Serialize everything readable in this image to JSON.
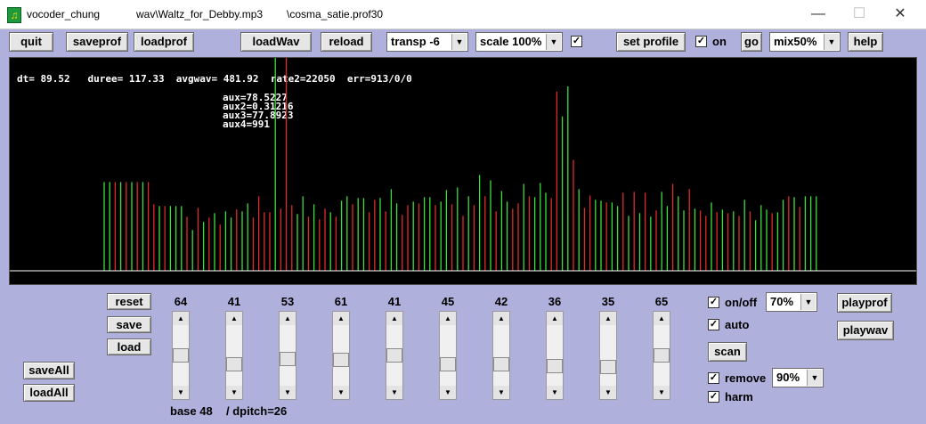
{
  "window": {
    "app_name": "vocoder_chung",
    "file": "wav\\Waltz_for_Debby.mp3",
    "profile": "\\cosma_satie.prof30",
    "app_icon": "clef-icon"
  },
  "toolbar": {
    "quit": "quit",
    "saveprof": "saveprof",
    "loadprof": "loadprof",
    "loadwav": "loadWav",
    "reload": "reload",
    "transp_value": "transp -6",
    "scale_value": "scale 100%",
    "scale_checked": true,
    "set_profile": "set profile",
    "on_label": "on",
    "on_checked": true,
    "go": "go",
    "mix_value": "mix50%",
    "help": "help"
  },
  "display": {
    "stats": "dt= 89.52   duree= 117.33  avgwav= 481.92  rate2=22050  err=913/0/0",
    "aux": [
      "aux=78.5227",
      "aux2=0.31216",
      "aux3=77.8923",
      "aux4=991"
    ],
    "colors": {
      "green": "#3ce03c",
      "red": "#e02a2a",
      "baseline": "#ffffff"
    }
  },
  "chart_data": {
    "type": "bar",
    "title": "",
    "baseline": 0,
    "ylim": [
      0,
      240
    ],
    "values": [
      100,
      100,
      100,
      100,
      100,
      100,
      100,
      100,
      100,
      75,
      73,
      73,
      73,
      73,
      73,
      61,
      46,
      71,
      55,
      60,
      65,
      52,
      67,
      60,
      69,
      67,
      76,
      60,
      84,
      66,
      66,
      242,
      70,
      243,
      74,
      64,
      84,
      61,
      75,
      58,
      70,
      66,
      61,
      79,
      84,
      75,
      82,
      82,
      66,
      80,
      82,
      67,
      92,
      76,
      63,
      74,
      78,
      76,
      83,
      83,
      74,
      78,
      91,
      75,
      94,
      62,
      84,
      74,
      108,
      84,
      102,
      67,
      90,
      78,
      70,
      76,
      98,
      84,
      83,
      99,
      88,
      82,
      202,
      174,
      208,
      125,
      92,
      71,
      85,
      80,
      79,
      77,
      77,
      73,
      88,
      62,
      89,
      65,
      88,
      61,
      68,
      89,
      73,
      98,
      84,
      68,
      92,
      70,
      68,
      62,
      77,
      66,
      69,
      65,
      67,
      62,
      80,
      67,
      57,
      74,
      69,
      65,
      66,
      80,
      84,
      83,
      72,
      84,
      84,
      84
    ],
    "colors": [
      "g",
      "g",
      "r",
      "g",
      "r",
      "g",
      "r",
      "g",
      "r",
      "r",
      "g",
      "r",
      "g",
      "g",
      "g",
      "r",
      "g",
      "r",
      "g",
      "r",
      "g",
      "r",
      "g",
      "g",
      "r",
      "g",
      "g",
      "r",
      "r",
      "r",
      "r",
      "g",
      "r",
      "r",
      "r",
      "g",
      "g",
      "r",
      "g",
      "r",
      "r",
      "g",
      "r",
      "g",
      "g",
      "r",
      "g",
      "g",
      "r",
      "r",
      "g",
      "r",
      "g",
      "g",
      "r",
      "r",
      "g",
      "r",
      "g",
      "g",
      "r",
      "g",
      "g",
      "r",
      "g",
      "r",
      "g",
      "r",
      "g",
      "r",
      "g",
      "r",
      "g",
      "g",
      "r",
      "r",
      "g",
      "r",
      "g",
      "g",
      "g",
      "r",
      "r",
      "g",
      "g",
      "r",
      "g",
      "r",
      "r",
      "g",
      "g",
      "r",
      "g",
      "g",
      "r",
      "g",
      "r",
      "g",
      "r",
      "g",
      "r",
      "g",
      "g",
      "r",
      "g",
      "g",
      "r",
      "g",
      "r",
      "r",
      "g",
      "r",
      "g",
      "r",
      "g",
      "r",
      "g",
      "r",
      "g",
      "g",
      "g",
      "r",
      "g",
      "g",
      "r",
      "g",
      "r",
      "g",
      "g",
      "g"
    ]
  },
  "left_buttons": {
    "reset": "reset",
    "save": "save",
    "load": "load",
    "saveall": "saveAll",
    "loadall": "loadAll"
  },
  "sliders": [
    {
      "label": "64",
      "level": 0.5
    },
    {
      "label": "41",
      "level": 0.7
    },
    {
      "label": "53",
      "level": 0.57
    },
    {
      "label": "61",
      "level": 0.6
    },
    {
      "label": "41",
      "level": 0.5
    },
    {
      "label": "45",
      "level": 0.7
    },
    {
      "label": "42",
      "level": 0.7
    },
    {
      "label": "36",
      "level": 0.74
    },
    {
      "label": "35",
      "level": 0.75
    },
    {
      "label": "65",
      "level": 0.5
    }
  ],
  "bottom": {
    "base": "base 48",
    "dpitch": "/ dpitch=26",
    "onoff_label": "on/off",
    "onoff_checked": true,
    "onoff_value": "70%",
    "auto_label": "auto",
    "auto_checked": true,
    "scan": "scan",
    "remove_label": "remove",
    "remove_checked": true,
    "remove_value": "90%",
    "harm_label": "harm",
    "harm_checked": true,
    "playprof": "playprof",
    "playwav": "playwav"
  }
}
